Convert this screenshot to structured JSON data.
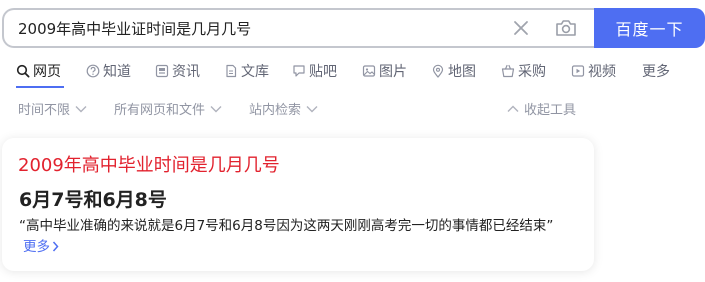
{
  "search": {
    "query": "2009年高中毕业证时间是几月几号",
    "button_label": "百度一下"
  },
  "tabs": [
    {
      "label": "网页",
      "icon": "search-icon",
      "active": true
    },
    {
      "label": "知道",
      "icon": "question-circle-icon"
    },
    {
      "label": "资讯",
      "icon": "news-icon"
    },
    {
      "label": "文库",
      "icon": "document-icon"
    },
    {
      "label": "贴吧",
      "icon": "tieba-icon"
    },
    {
      "label": "图片",
      "icon": "image-icon"
    },
    {
      "label": "地图",
      "icon": "map-pin-icon"
    },
    {
      "label": "采购",
      "icon": "shopping-basket-icon"
    },
    {
      "label": "视频",
      "icon": "play-icon"
    },
    {
      "label": "更多"
    }
  ],
  "filters": {
    "time": "时间不限",
    "type": "所有网页和文件",
    "site": "站内检索",
    "collapse": "收起工具"
  },
  "result": {
    "title": "2009年高中毕业时间是几月几号",
    "answer": "6月7号和6月8号",
    "snippet": "“高中毕业准确的来说就是6月7号和6月8号因为这两天刚刚高考完一切的事情都已经结束”",
    "more": "更多"
  },
  "colors": {
    "accent": "#4e6ef2",
    "title_red": "#e2222e",
    "muted": "#9195a3"
  }
}
